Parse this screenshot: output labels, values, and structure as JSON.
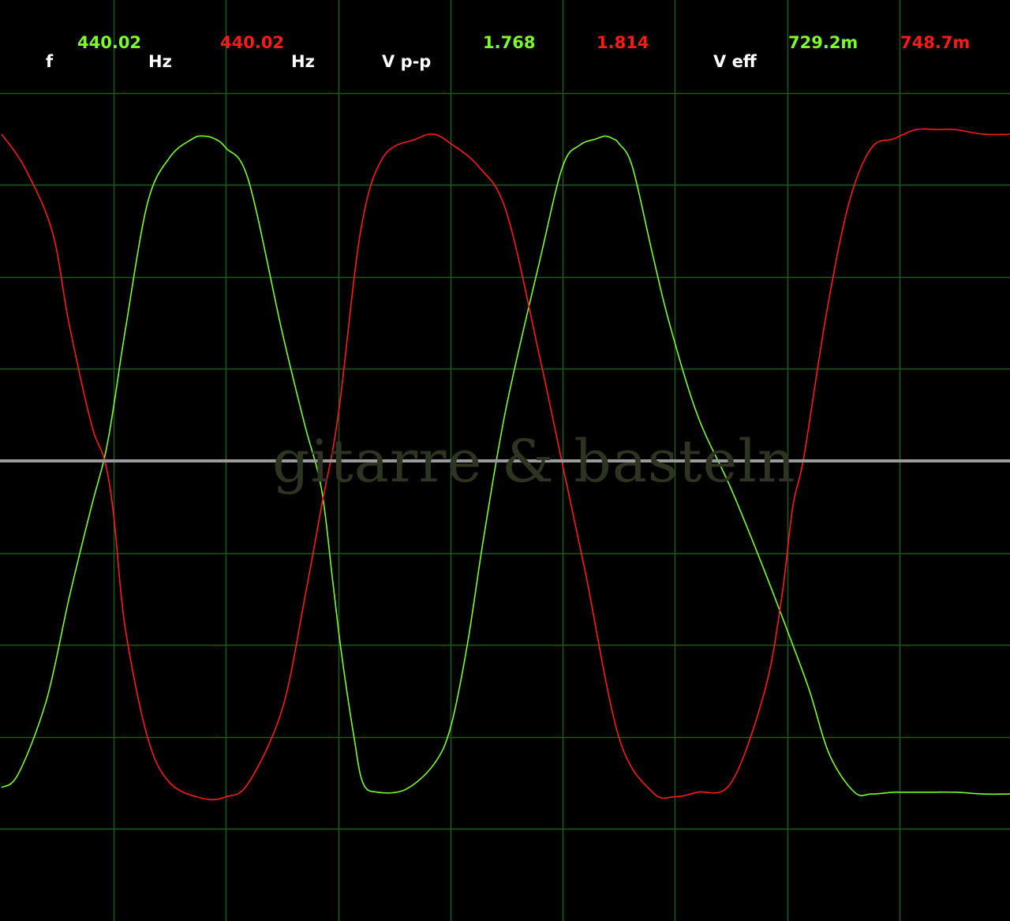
{
  "colors": {
    "background": "#000000",
    "grid": "#1f5a1f",
    "channel_a": "#7cfc2c",
    "channel_b": "#ff1a1a",
    "labels": "#ffffff",
    "zero_line": "#9a9a9a"
  },
  "readouts": {
    "freq_label": "f",
    "freq_a": "440.02",
    "freq_unit_a": "Hz",
    "freq_b": "440.02",
    "freq_unit_b": "Hz",
    "vpp_label": "V p-p",
    "vpp_a": "1.768",
    "vpp_b": "1.814",
    "veff_label": "V eff",
    "veff_a": "729.2m",
    "veff_b": "748.7m"
  },
  "watermark": "gitarre & basteln",
  "chart_data": {
    "type": "line",
    "grid": true,
    "xlim": [
      0,
      9
    ],
    "ylim": [
      -5,
      5
    ],
    "series": [
      {
        "color": "#7cfc2c",
        "x": [
          0,
          0.15,
          0.4,
          0.6,
          0.8,
          0.92,
          1.0,
          1.1,
          1.3,
          1.5,
          1.7,
          1.8,
          1.9,
          2.0,
          2.2,
          2.5,
          2.7,
          2.85,
          2.95,
          3.03,
          3.14,
          3.22,
          3.35,
          3.6,
          3.85,
          4.0,
          4.15,
          4.3,
          4.5,
          4.8,
          5.0,
          5.15,
          5.3,
          5.38,
          5.45,
          5.5,
          5.62,
          5.8,
          5.95,
          6.2,
          6.5,
          6.8,
          7.05,
          7.2,
          7.38,
          7.6,
          7.75,
          7.95,
          8.0,
          8.1,
          8.3,
          8.5,
          8.75,
          9.0
        ],
        "y": [
          -3.55,
          -3.4,
          -2.6,
          -1.5,
          -0.5,
          0.05,
          0.6,
          1.4,
          2.8,
          3.3,
          3.5,
          3.53,
          3.5,
          3.4,
          3.05,
          1.4,
          0.4,
          -0.3,
          -1.3,
          -2.1,
          -3.0,
          -3.5,
          -3.6,
          -3.57,
          -3.3,
          -2.9,
          -2.0,
          -0.8,
          0.6,
          2.2,
          3.2,
          3.43,
          3.5,
          3.53,
          3.5,
          3.45,
          3.2,
          2.25,
          1.5,
          0.5,
          -0.3,
          -1.2,
          -2.0,
          -2.5,
          -3.2,
          -3.6,
          -3.62,
          -3.6,
          -3.6,
          -3.6,
          -3.6,
          -3.6,
          -3.62,
          -3.62
        ]
      },
      {
        "color": "#ff1a1a",
        "x": [
          0,
          0.2,
          0.45,
          0.6,
          0.8,
          0.92,
          1.0,
          1.1,
          1.3,
          1.5,
          1.8,
          2.0,
          2.2,
          2.5,
          2.7,
          2.85,
          3.0,
          3.2,
          3.4,
          3.7,
          3.85,
          4.0,
          4.25,
          4.5,
          4.8,
          5.0,
          5.2,
          5.5,
          5.8,
          6.0,
          6.2,
          6.5,
          6.8,
          6.95,
          7.05,
          7.15,
          7.35,
          7.55,
          7.75,
          7.95,
          8.15,
          8.35,
          8.5,
          8.75,
          9.0
        ],
        "y": [
          3.55,
          3.2,
          2.5,
          1.5,
          0.4,
          0.0,
          -0.6,
          -1.8,
          -3.0,
          -3.5,
          -3.67,
          -3.65,
          -3.5,
          -2.7,
          -1.5,
          -0.5,
          0.5,
          2.5,
          3.3,
          3.5,
          3.55,
          3.45,
          3.2,
          2.7,
          1.1,
          -0.05,
          -1.2,
          -3.0,
          -3.6,
          -3.65,
          -3.6,
          -3.5,
          -2.5,
          -1.5,
          -0.5,
          0.05,
          1.6,
          2.8,
          3.4,
          3.5,
          3.6,
          3.6,
          3.6,
          3.55,
          3.55
        ]
      }
    ]
  }
}
